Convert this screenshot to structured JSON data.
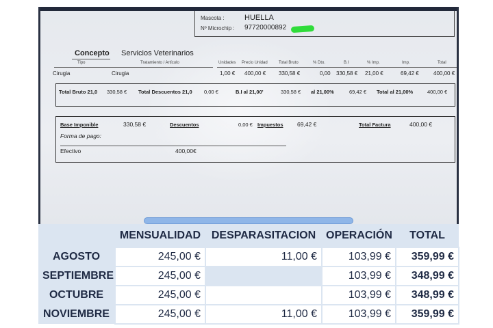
{
  "invoice": {
    "pet_label": "Mascota :",
    "pet_name": "HUELLA",
    "chip_label": "Nº Microchip :",
    "chip_number": "97720000892",
    "concept_label": "Concepto",
    "concept_value": "Servicios Veterinarios",
    "columns": [
      "Tipo",
      "Tratamiento / Artículo",
      "Unidades",
      "Precio Unidad",
      "Total Bruto",
      "% Dto.",
      "B.I",
      "% Imp.",
      "Imp.",
      "Total"
    ],
    "line": {
      "tipo": "Cirugia",
      "tratamiento": "Cirugia",
      "unidades": "1,00 €",
      "precio": "400,00 €",
      "bruto": "330,58 €",
      "dto": "0,00",
      "bi": "330,58 €",
      "imp_pct": "21,00 €",
      "imp": "69,42 €",
      "total": "400,00 €"
    },
    "totals": {
      "bruto_label": "Total Bruto 21,0",
      "bruto_value": "330,58 €",
      "desc_label": "Total Descuentos 21,0",
      "desc_value": "0,00 €",
      "bi_label": "B.I al 21,00'",
      "bi_value": "330,58 €",
      "imp_label": "al 21,00%",
      "imp_value": "69,42 €",
      "total_label": "Total al 21,00%",
      "total_value": "400,00 €"
    },
    "summary": {
      "base_label": "Base Imponible",
      "base_value": "330,58 €",
      "desc_label": "Descuentos",
      "desc_value": "0,00 €",
      "imp_label": "Impuestos",
      "imp_value": "69,42 €",
      "factura_label": "Total Factura",
      "factura_value": "400,00 €",
      "pago_label": "Forma de pago:",
      "efectivo_label": "Efectivo",
      "efectivo_value": "400,00€"
    },
    "highlight_color": "#2fdc3a"
  },
  "table": {
    "headers": [
      "MENSUALIDAD",
      "DESPARASITACION",
      "OPERACIÓN",
      "TOTAL"
    ],
    "rows": [
      {
        "month": "AGOSTO",
        "mensualidad": "245,00 €",
        "desparasitacion": "11,00 €",
        "operacion": "103,99 €",
        "total": "359,99 €"
      },
      {
        "month": "SEPTIEMBRE",
        "mensualidad": "245,00 €",
        "desparasitacion": "",
        "operacion": "103,99 €",
        "total": "348,99 €"
      },
      {
        "month": "OCTUBRE",
        "mensualidad": "245,00 €",
        "desparasitacion": "",
        "operacion": "103,99 €",
        "total": "348,99 €"
      },
      {
        "month": "NOVIEMBRE",
        "mensualidad": "245,00 €",
        "desparasitacion": "11,00 €",
        "operacion": "103,99 €",
        "total": "359,99 €"
      }
    ],
    "header_color": "#1f2a44",
    "band_color": "#dbe5f1"
  }
}
